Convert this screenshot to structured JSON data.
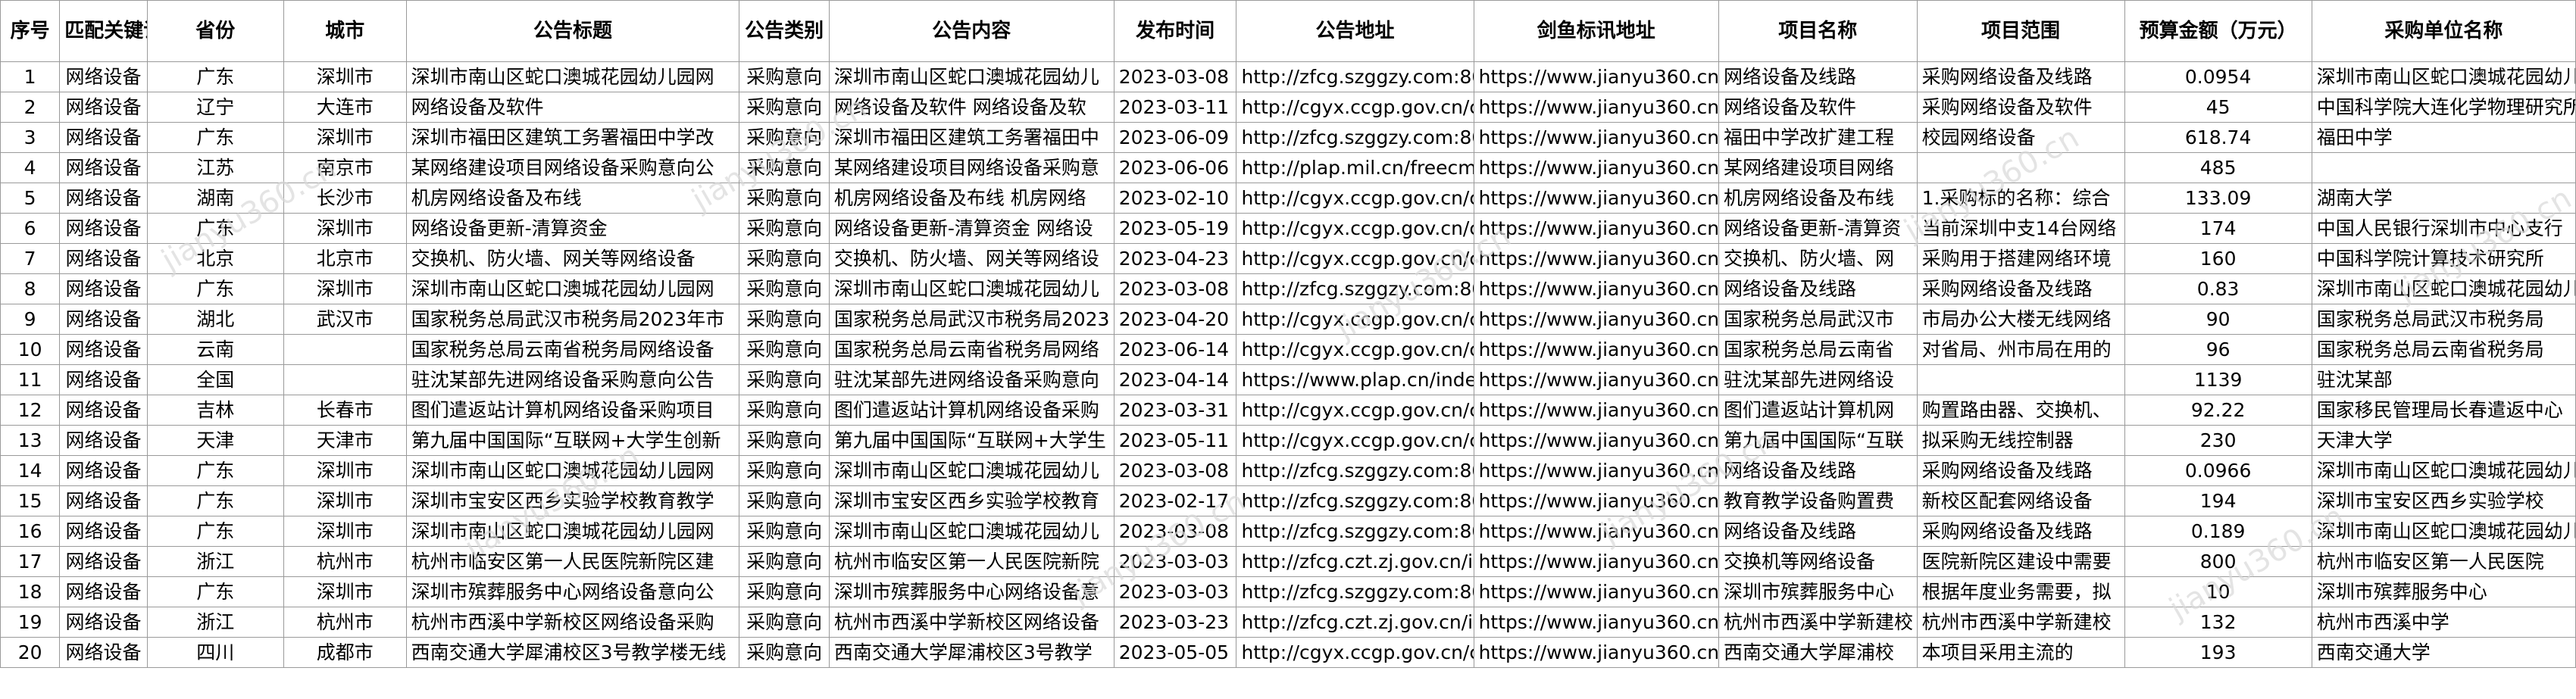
{
  "watermark": "jianyu360.cn",
  "headers": [
    "序号",
    "匹配关键词",
    "省份",
    "城市",
    "公告标题",
    "公告类别",
    "公告内容",
    "发布时间",
    "公告地址",
    "剑鱼标讯地址",
    "项目名称",
    "项目范围",
    "预算金额（万元）",
    "采购单位名称"
  ],
  "rows": [
    [
      "1",
      "网络设备",
      "广东",
      "深圳市",
      "深圳市南山区蛇口澳城花园幼儿园网",
      "采购意向",
      "深圳市南山区蛇口澳城花园幼儿",
      "2023-03-08",
      "http://zfcg.szggzy.com:8081",
      "https://www.jianyu360.cn/ar",
      "网络设备及线路",
      "采购网络设备及线路",
      "0.0954",
      "深圳市南山区蛇口澳城花园幼儿"
    ],
    [
      "2",
      "网络设备",
      "辽宁",
      "大连市",
      "网络设备及软件",
      "采购意向",
      "网络设备及软件 网络设备及软",
      "2023-03-11",
      "http://cgyx.ccgp.gov.cn/cgy",
      "https://www.jianyu360.cn/ar",
      "网络设备及软件",
      "采购网络设备及软件",
      "45",
      "中国科学院大连化学物理研究所"
    ],
    [
      "3",
      "网络设备",
      "广东",
      "深圳市",
      "深圳市福田区建筑工务署福田中学改",
      "采购意向",
      "深圳市福田区建筑工务署福田中",
      "2023-06-09",
      "http://zfcg.szggzy.com:8081",
      "https://www.jianyu360.cn/ar",
      "福田中学改扩建工程",
      "校园网络设备",
      "618.74",
      "福田中学"
    ],
    [
      "4",
      "网络设备",
      "江苏",
      "南京市",
      "某网络建设项目网络设备采购意向公",
      "采购意向",
      "某网络建设项目网络设备采购意",
      "2023-06-06",
      "http://plap.mil.cn/freecms/si",
      "https://www.jianyu360.cn/ar",
      "某网络建设项目网络",
      "",
      "485",
      ""
    ],
    [
      "5",
      "网络设备",
      "湖南",
      "长沙市",
      "机房网络设备及布线",
      "采购意向",
      "机房网络设备及布线 机房网络",
      "2023-02-10",
      "http://cgyx.ccgp.gov.cn/cgy",
      "https://www.jianyu360.cn/ar",
      "机房网络设备及布线",
      "1.采购标的名称：综合",
      "133.09",
      "湖南大学"
    ],
    [
      "6",
      "网络设备",
      "广东",
      "深圳市",
      "网络设备更新-清算资金",
      "采购意向",
      "网络设备更新-清算资金 网络设",
      "2023-05-19",
      "http://cgyx.ccgp.gov.cn/cgy",
      "https://www.jianyu360.cn/ar",
      "网络设备更新-清算资",
      "当前深圳中支14台网络",
      "174",
      "中国人民银行深圳市中心支行"
    ],
    [
      "7",
      "网络设备",
      "北京",
      "北京市",
      "交换机、防火墙、网关等网络设备",
      "采购意向",
      "交换机、防火墙、网关等网络设",
      "2023-04-23",
      "http://cgyx.ccgp.gov.cn/cgy",
      "https://www.jianyu360.cn/ar",
      "交换机、防火墙、网",
      "采购用于搭建网络环境",
      "160",
      "中国科学院计算技术研究所"
    ],
    [
      "8",
      "网络设备",
      "广东",
      "深圳市",
      "深圳市南山区蛇口澳城花园幼儿园网",
      "采购意向",
      "深圳市南山区蛇口澳城花园幼儿",
      "2023-03-08",
      "http://zfcg.szggzy.com:8081",
      "https://www.jianyu360.cn/ar",
      "网络设备及线路",
      "采购网络设备及线路",
      "0.83",
      "深圳市南山区蛇口澳城花园幼儿"
    ],
    [
      "9",
      "网络设备",
      "湖北",
      "武汉市",
      "国家税务总局武汉市税务局2023年市",
      "采购意向",
      "国家税务总局武汉市税务局2023",
      "2023-04-20",
      "http://cgyx.ccgp.gov.cn/cgy",
      "https://www.jianyu360.cn/ar",
      "国家税务总局武汉市",
      "市局办公大楼无线网络",
      "90",
      "国家税务总局武汉市税务局"
    ],
    [
      "10",
      "网络设备",
      "云南",
      "",
      "国家税务总局云南省税务局网络设备",
      "采购意向",
      "国家税务总局云南省税务局网络",
      "2023-06-14",
      "http://cgyx.ccgp.gov.cn/cgy",
      "https://www.jianyu360.cn/ar",
      "国家税务总局云南省",
      "对省局、州市局在用的",
      "96",
      "国家税务总局云南省税务局"
    ],
    [
      "11",
      "网络设备",
      "全国",
      "",
      "驻沈某部先进网络设备采购意向公告",
      "采购意向",
      "驻沈某部先进网络设备采购意向",
      "2023-04-14",
      "https://www.plap.cn/index/",
      "https://www.jianyu360.cn/ar",
      "驻沈某部先进网络设",
      "",
      "1139",
      "驻沈某部"
    ],
    [
      "12",
      "网络设备",
      "吉林",
      "长春市",
      "图们遣返站计算机网络设备采购项目",
      "采购意向",
      "图们遣返站计算机网络设备采购",
      "2023-03-31",
      "http://cgyx.ccgp.gov.cn/cgy",
      "https://www.jianyu360.cn/ar",
      "图们遣返站计算机网",
      "购置路由器、交换机、",
      "92.22",
      "国家移民管理局长春遣返中心"
    ],
    [
      "13",
      "网络设备",
      "天津",
      "天津市",
      "第九届中国国际“互联网+大学生创新",
      "采购意向",
      "第九届中国国际“互联网+大学生",
      "2023-05-11",
      "http://cgyx.ccgp.gov.cn/cgy",
      "https://www.jianyu360.cn/ar",
      "第九届中国国际“互联",
      "拟采购无线控制器",
      "230",
      "天津大学"
    ],
    [
      "14",
      "网络设备",
      "广东",
      "深圳市",
      "深圳市南山区蛇口澳城花园幼儿园网",
      "采购意向",
      "深圳市南山区蛇口澳城花园幼儿",
      "2023-03-08",
      "http://zfcg.szggzy.com:8081",
      "https://www.jianyu360.cn/ar",
      "网络设备及线路",
      "采购网络设备及线路",
      "0.0966",
      "深圳市南山区蛇口澳城花园幼儿"
    ],
    [
      "15",
      "网络设备",
      "广东",
      "深圳市",
      "深圳市宝安区西乡实验学校教育教学",
      "采购意向",
      "深圳市宝安区西乡实验学校教育",
      "2023-02-17",
      "http://zfcg.szggzy.com:8081",
      "https://www.jianyu360.cn/ar",
      "教育教学设备购置费",
      "新校区配套网络设备",
      "194",
      "深圳市宝安区西乡实验学校"
    ],
    [
      "16",
      "网络设备",
      "广东",
      "深圳市",
      "深圳市南山区蛇口澳城花园幼儿园网",
      "采购意向",
      "深圳市南山区蛇口澳城花园幼儿",
      "2023-03-08",
      "http://zfcg.szggzy.com:8081",
      "https://www.jianyu360.cn/ar",
      "网络设备及线路",
      "采购网络设备及线路",
      "0.189",
      "深圳市南山区蛇口澳城花园幼儿"
    ],
    [
      "17",
      "网络设备",
      "浙江",
      "杭州市",
      "杭州市临安区第一人民医院新院区建",
      "采购意向",
      "杭州市临安区第一人民医院新院",
      "2023-03-03",
      "http://zfcg.czt.zj.gov.cn/inn",
      "https://www.jianyu360.cn/ar",
      "交换机等网络设备",
      "医院新院区建设中需要",
      "800",
      "杭州市临安区第一人民医院"
    ],
    [
      "18",
      "网络设备",
      "广东",
      "深圳市",
      "深圳市殡葬服务中心网络设备意向公",
      "采购意向",
      "深圳市殡葬服务中心网络设备意",
      "2023-03-03",
      "http://zfcg.szggzy.com:8081",
      "https://www.jianyu360.cn/ar",
      "深圳市殡葬服务中心",
      "根据年度业务需要，拟",
      "10",
      "深圳市殡葬服务中心"
    ],
    [
      "19",
      "网络设备",
      "浙江",
      "杭州市",
      "杭州市西溪中学新校区网络设备采购",
      "采购意向",
      "杭州市西溪中学新校区网络设备",
      "2023-03-23",
      "http://zfcg.czt.zj.gov.cn/inn",
      "https://www.jianyu360.cn/ar",
      "杭州市西溪中学新建校",
      "杭州市西溪中学新建校",
      "132",
      "杭州市西溪中学"
    ],
    [
      "20",
      "网络设备",
      "四川",
      "成都市",
      "西南交通大学犀浦校区3号教学楼无线",
      "采购意向",
      "西南交通大学犀浦校区3号教学",
      "2023-05-05",
      "http://cgyx.ccgp.gov.cn/cgy",
      "https://www.jianyu360.cn/ar",
      "西南交通大学犀浦校",
      "本项目采用主流的",
      "193",
      "西南交通大学"
    ]
  ]
}
